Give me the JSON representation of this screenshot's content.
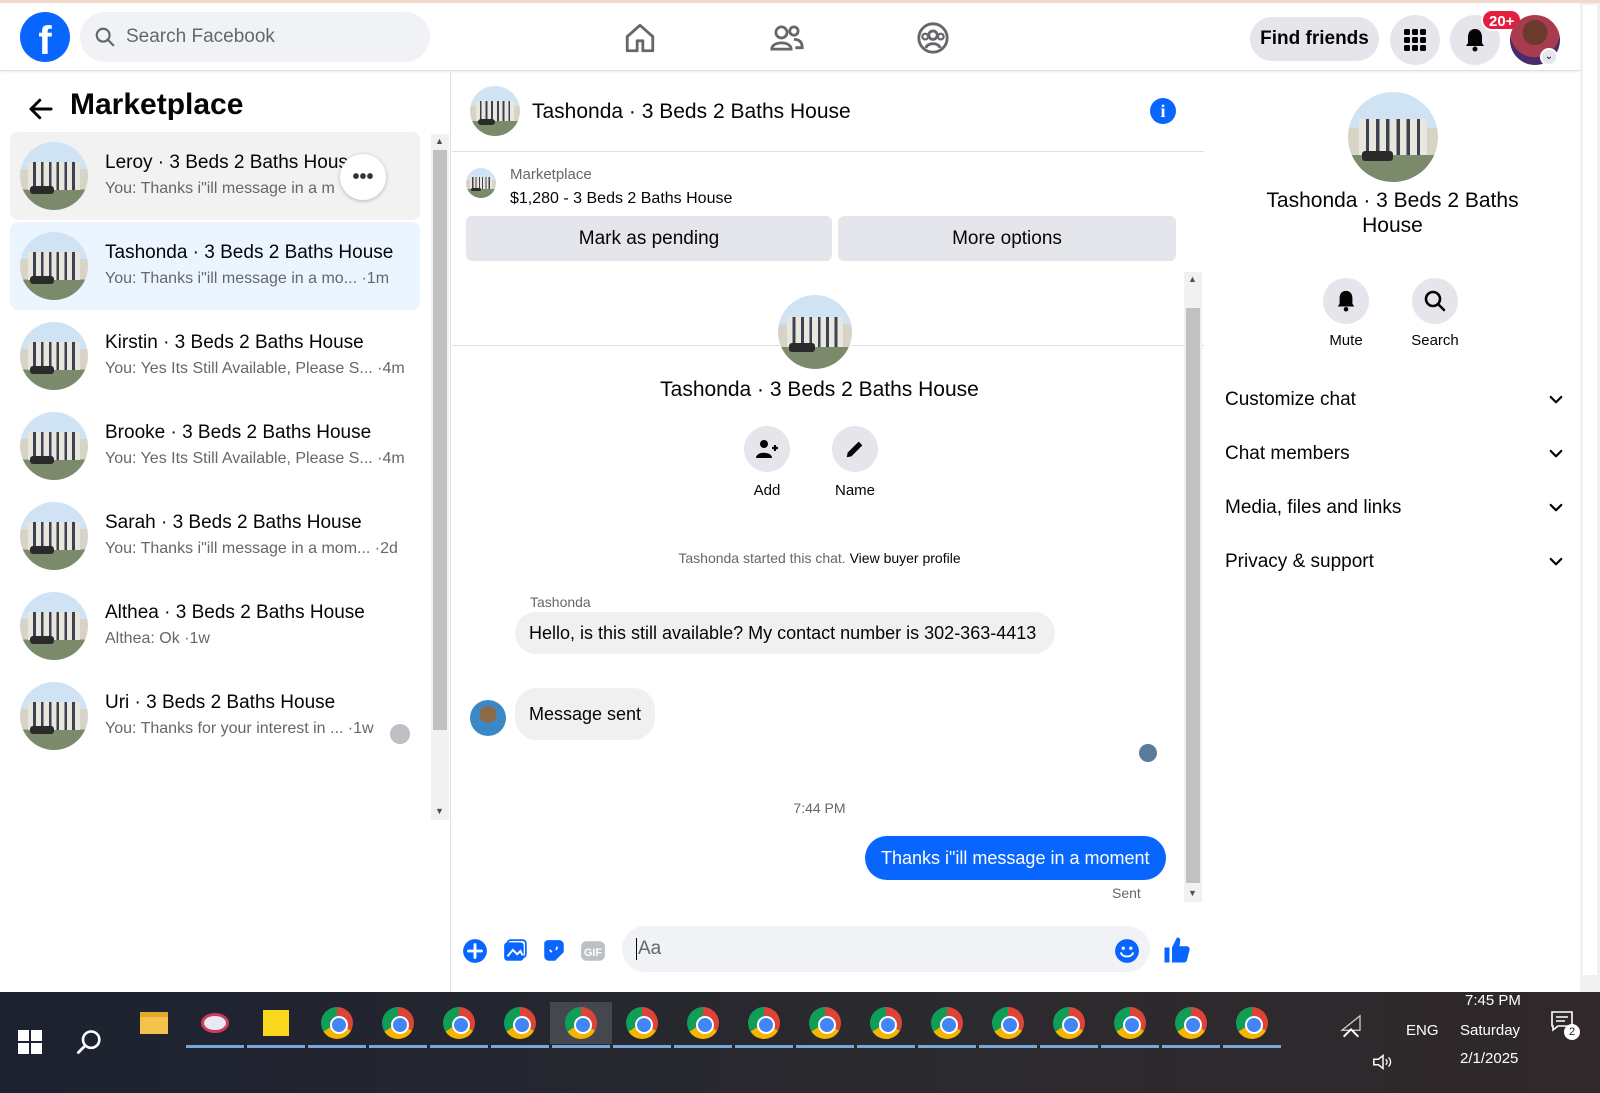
{
  "header": {
    "search_placeholder": "Search Facebook",
    "find_friends": "Find friends",
    "notif_badge": "20+"
  },
  "marketplace": {
    "title": "Marketplace",
    "conversations": [
      {
        "name": "Leroy · 3 Beds 2 Baths House",
        "snippet": "You: Thanks i\"ill message in a mo...·1m"
      },
      {
        "name": "Tashonda · 3 Beds 2 Baths House",
        "snippet": "You: Thanks i\"ill message in a mo... ·1m"
      },
      {
        "name": "Kirstin · 3 Beds 2 Baths House",
        "snippet": "You: Yes Its Still Available, Please S... ·4m"
      },
      {
        "name": "Brooke · 3 Beds 2 Baths House",
        "snippet": "You: Yes Its Still Available, Please S... ·4m"
      },
      {
        "name": "Sarah · 3 Beds 2 Baths House",
        "snippet": "You: Thanks i\"ill message in a mom... ·2d"
      },
      {
        "name": "Althea · 3 Beds 2 Baths House",
        "snippet": "Althea: Ok ·1w"
      },
      {
        "name": "Uri · 3 Beds 2 Baths House",
        "snippet": "You: Thanks for your interest in ... ·1w"
      }
    ]
  },
  "chat": {
    "title": "Tashonda · 3 Beds 2 Baths House",
    "listing_source": "Marketplace",
    "listing_price": "$1,280 - 3 Beds 2 Baths House",
    "mark_pending": "Mark as pending",
    "more_options": "More options",
    "thread_title": "Tashonda · 3 Beds 2 Baths House",
    "add_label": "Add",
    "name_label": "Name",
    "started_text": "Tashonda started this chat.",
    "view_profile": "View buyer profile",
    "sender": "Tashonda",
    "msg_in_1": "Hello, is this still available? My contact number is 302-363-4413",
    "msg_in_2": "Message sent",
    "timestamp": "7:44 PM",
    "msg_out": "Thanks i\"ill message in a moment",
    "sent": "Sent",
    "composer_placeholder": "Aa"
  },
  "details": {
    "title": "Tashonda · 3 Beds 2 Baths House",
    "mute": "Mute",
    "search": "Search",
    "sections": [
      "Customize chat",
      "Chat members",
      "Media, files and links",
      "Privacy & support"
    ]
  },
  "taskbar": {
    "lang": "ENG",
    "time": "7:45 PM",
    "day": "Saturday",
    "date": "2/1/2025",
    "notif_count": "2"
  }
}
